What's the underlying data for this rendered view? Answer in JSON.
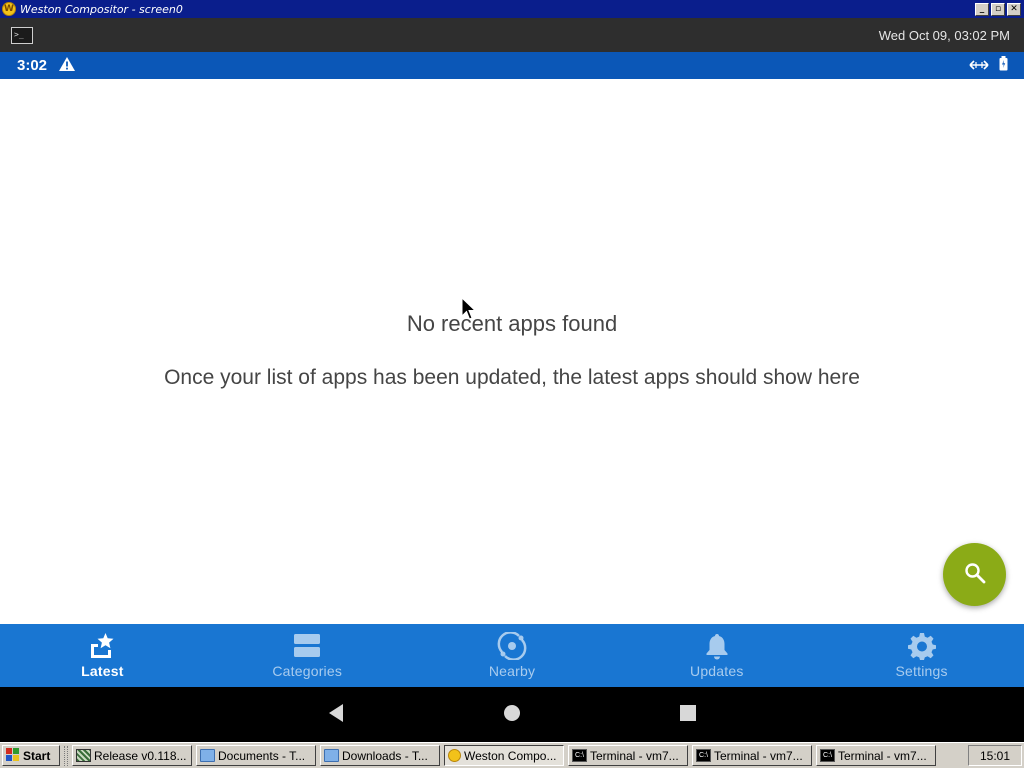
{
  "window": {
    "title": "Weston Compositor - screen0",
    "controls": [
      "_",
      "▫",
      "✕"
    ]
  },
  "weston_panel": {
    "clock": "Wed Oct 09, 03:02 PM",
    "launcher_icon": "terminal-icon"
  },
  "status_bar": {
    "time": "3:02",
    "icons": [
      "warning-icon",
      "network-arrows-icon",
      "battery-icon"
    ]
  },
  "content": {
    "empty_title": "No recent apps found",
    "empty_message": "Once your list of apps has been updated, the latest apps should show here"
  },
  "fab": {
    "icon": "search-icon",
    "color": "#8bab17"
  },
  "bottom_nav": {
    "background": "#1976d2",
    "items": [
      {
        "label": "Latest",
        "icon": "latest-star-icon",
        "active": true
      },
      {
        "label": "Categories",
        "icon": "categories-icon",
        "active": false
      },
      {
        "label": "Nearby",
        "icon": "nearby-icon",
        "active": false
      },
      {
        "label": "Updates",
        "icon": "bell-icon",
        "active": false
      },
      {
        "label": "Settings",
        "icon": "gear-icon",
        "active": false
      }
    ]
  },
  "system_nav": [
    "back-icon",
    "home-icon",
    "recents-icon"
  ],
  "taskbar": {
    "start_label": "Start",
    "tasks": [
      {
        "label": "Release v0.118...",
        "icon": "release-icon",
        "active": false
      },
      {
        "label": "Documents - T...",
        "icon": "folder-icon",
        "active": false
      },
      {
        "label": "Downloads - T...",
        "icon": "folder-icon",
        "active": false
      },
      {
        "label": "Weston Compo...",
        "icon": "weston-icon",
        "active": true
      },
      {
        "label": "Terminal - vm7...",
        "icon": "terminal-icon",
        "active": false
      },
      {
        "label": "Terminal - vm7...",
        "icon": "terminal-icon",
        "active": false
      },
      {
        "label": "Terminal - vm7...",
        "icon": "terminal-icon",
        "active": false
      }
    ],
    "clock": "15:01"
  }
}
